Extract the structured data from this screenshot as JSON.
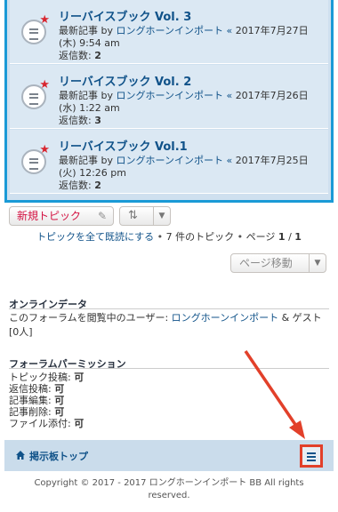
{
  "topics": [
    {
      "title": "リーバイスブック Vol. 3",
      "meta_prefix": "最新記事 by ",
      "author": "ロングホーンインポート",
      "sep": " « ",
      "date": "2017年7月27日(木) 9:54 am",
      "replies_label": "返信数: ",
      "replies": "2"
    },
    {
      "title": "リーバイスブック Vol. 2",
      "meta_prefix": "最新記事 by ",
      "author": "ロングホーンインポート",
      "sep": " « ",
      "date": "2017年7月26日(水) 1:22 am",
      "replies_label": "返信数: ",
      "replies": "3"
    },
    {
      "title": "リーバイスブック Vol.1",
      "meta_prefix": "最新記事 by ",
      "author": "ロングホーンインポート",
      "sep": " « ",
      "date": "2017年7月25日(火) 12:26 pm",
      "replies_label": "返信数: ",
      "replies": "2"
    }
  ],
  "actions": {
    "new_topic": "新規トピック",
    "pencil_icon": "pencil-icon",
    "sort_icon": "sort-icon"
  },
  "pagination": {
    "mark_read": "トピックを全て既読にする",
    "bullet1": " • ",
    "topic_count": "7 件のトピック",
    "bullet2": " • ",
    "page_label": "ページ ",
    "current_page": "1",
    "of": " / ",
    "total_pages": "1"
  },
  "jump": {
    "label": "ページ移動"
  },
  "online": {
    "title": "オンラインデータ",
    "text_prefix": "このフォーラムを閲覧中のユーザー: ",
    "user": "ロングホーンインポート",
    "text_suffix": " & ゲスト [0人]"
  },
  "permissions": {
    "title": "フォーラムパーミッション",
    "items": [
      {
        "label": "トピック投稿: ",
        "value": "可"
      },
      {
        "label": "返信投稿: ",
        "value": "可"
      },
      {
        "label": "記事編集: ",
        "value": "可"
      },
      {
        "label": "記事削除: ",
        "value": "可"
      },
      {
        "label": "ファイル添付: ",
        "value": "可"
      }
    ]
  },
  "footer": {
    "home_label": "掲示板トップ",
    "home_icon": "home-icon",
    "menu_icon": "hamburger-menu-icon"
  },
  "copyright": "Copyright © 2017 - 2017 ロングホーンインポート BB All rights reserved.",
  "colors": {
    "accent_border": "#1a9ad6",
    "link": "#105289",
    "new_topic": "#d31141",
    "annotation": "#e2402a"
  }
}
